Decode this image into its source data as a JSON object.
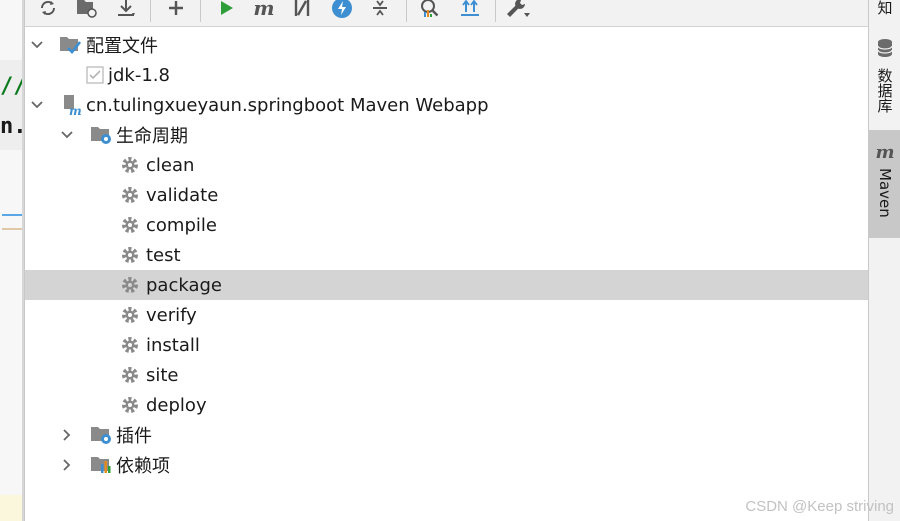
{
  "editor_fragments": {
    "line1": "//",
    "line2": "n."
  },
  "toolbar": {
    "buttons": [
      {
        "name": "reimport-all-icon"
      },
      {
        "name": "generate-sources-icon"
      },
      {
        "name": "download-sources-icon"
      },
      {
        "name": "add-project-icon"
      },
      {
        "name": "run-icon"
      },
      {
        "name": "execute-goal-icon"
      },
      {
        "name": "toggle-skip-tests-icon"
      },
      {
        "name": "offline-mode-icon"
      },
      {
        "name": "collapse-all-icon"
      },
      {
        "name": "show-dependencies-icon"
      },
      {
        "name": "expand-all-icon"
      },
      {
        "name": "settings-wrench-icon"
      }
    ]
  },
  "tree": {
    "profiles": {
      "label": "配置文件"
    },
    "jdk": {
      "label": "jdk-1.8",
      "checked": true
    },
    "project": {
      "label": "cn.tulingxueyaun.springboot Maven Webapp"
    },
    "lifecycle": {
      "label": "生命周期",
      "phases": [
        "clean",
        "validate",
        "compile",
        "test",
        "package",
        "verify",
        "install",
        "site",
        "deploy"
      ],
      "selected": "package"
    },
    "plugins": {
      "label": "插件"
    },
    "dependencies": {
      "label": "依赖项"
    }
  },
  "right_tabs": {
    "top_fragment": "知",
    "database": "数据库",
    "maven": "Maven",
    "active": "Maven"
  },
  "colors": {
    "selected_row": "#d4d4d4",
    "run_green": "#2e9e3a",
    "accent_blue": "#3d8fd1",
    "gear_gray": "#8a8a8a"
  },
  "watermark": "CSDN @Keep striving"
}
